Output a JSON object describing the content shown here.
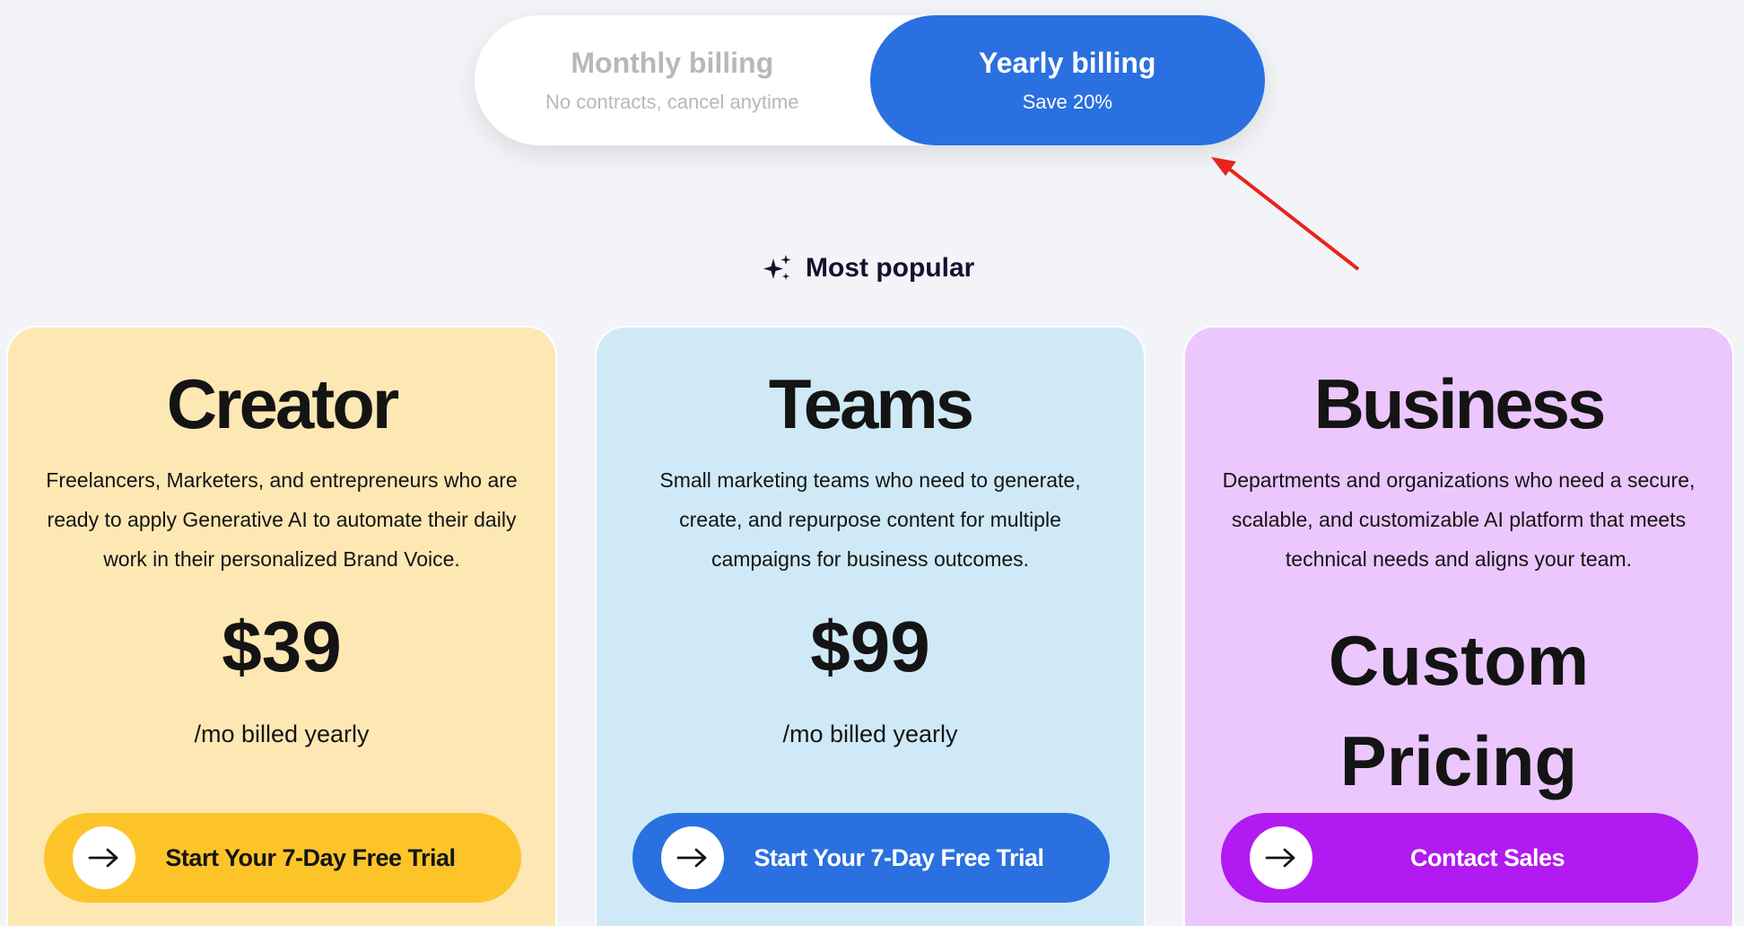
{
  "billing_toggle": {
    "monthly": {
      "title": "Monthly billing",
      "subtitle": "No contracts, cancel anytime"
    },
    "yearly": {
      "title": "Yearly billing",
      "subtitle": "Save 20%"
    },
    "selected": "yearly"
  },
  "most_popular": {
    "label": "Most popular",
    "icon": "sparkles-icon"
  },
  "plans": [
    {
      "name": "Creator",
      "description": "Freelancers, Marketers, and entrepreneurs who are ready to apply Generative AI to automate their daily work in their personalized Brand Voice.",
      "price": "$39",
      "period": "/mo billed yearly",
      "cta_label": "Start Your 7-Day Free Trial",
      "cta_icon": "arrow-right-icon",
      "color": "#fde8b4",
      "cta_color": "#fdc42a"
    },
    {
      "name": "Teams",
      "description": "Small marketing teams who need to generate, create, and repurpose content for multiple campaigns for business outcomes.",
      "price": "$99",
      "period": "/mo billed yearly",
      "cta_label": "Start Your 7-Day Free Trial",
      "cta_icon": "arrow-right-icon",
      "color": "#cfeaf6",
      "cta_color": "#2a70e0"
    },
    {
      "name": "Business",
      "description": "Departments and organizations who need a secure, scalable, and customizable AI platform that meets technical needs and aligns your team.",
      "price_line1": "Custom",
      "price_line2": "Pricing",
      "cta_label": "Contact Sales",
      "cta_icon": "arrow-right-icon",
      "color": "#ebc7fd",
      "cta_color": "#b11af0"
    }
  ],
  "annotation": {
    "type": "arrow",
    "color": "#e8231c"
  }
}
